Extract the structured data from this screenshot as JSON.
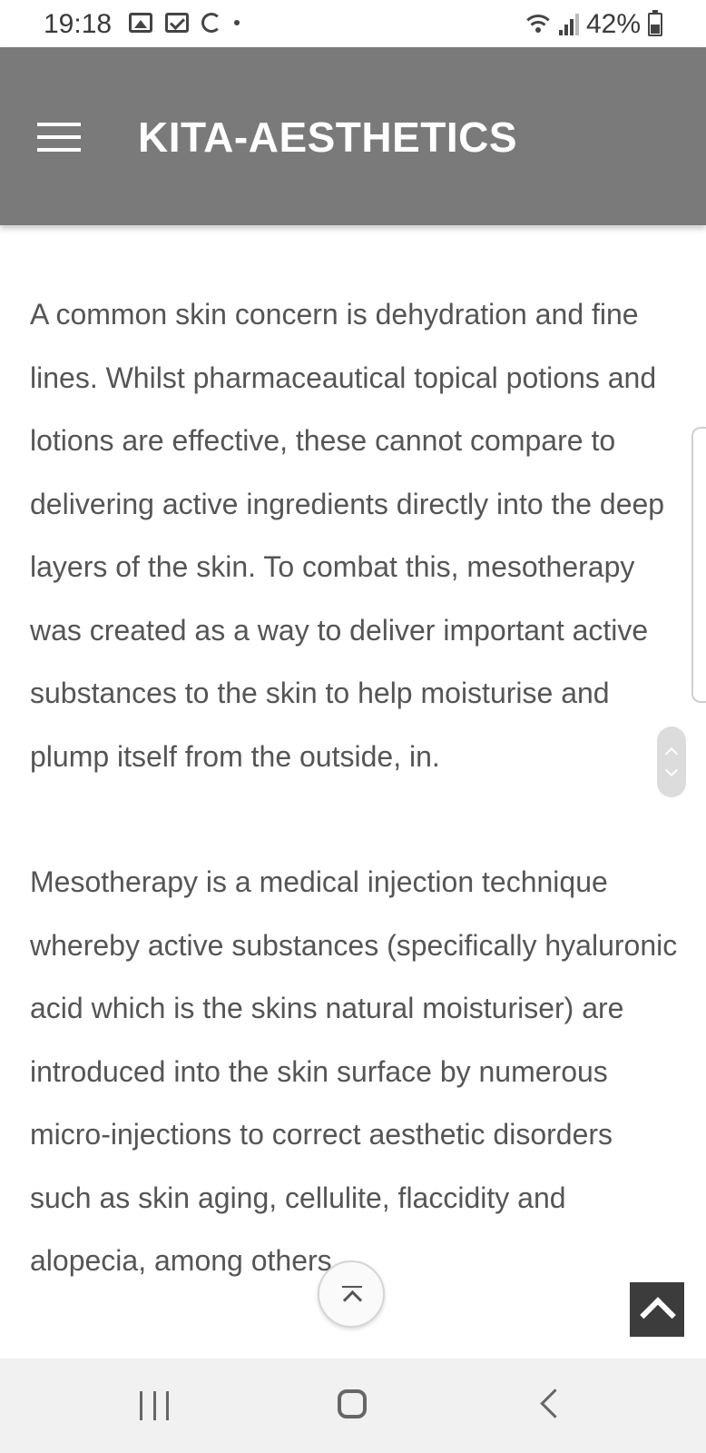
{
  "status_bar": {
    "time": "19:18",
    "battery": "42%",
    "left_icons": [
      "image-icon",
      "mail-icon",
      "sync-icon",
      "dot-icon"
    ],
    "right_icons": [
      "wifi-icon",
      "signal-icon",
      "battery-icon"
    ]
  },
  "header": {
    "title": "KITA-AESTHETICS",
    "background": "#7a7a7a",
    "menu_icon": "hamburger-menu-icon"
  },
  "article": {
    "paragraphs": [
      "A common skin concern is dehydration and fine lines. Whilst pharmaceautical topical potions and lotions are effective, these cannot compare to delivering active ingredients directly into the deep layers of the skin. To combat this, mesotherapy was created as a way to deliver important active substances to the skin to help moisturise and plump itself from the outside, in.",
      "Mesotherapy is a medical injection technique whereby active substances (specifically hyaluronic acid which is the skins natural moisturiser) are introduced into the skin surface by numerous micro-injections to correct aesthetic disorders such as skin aging, cellulite, flaccidity and alopecia, among others."
    ]
  },
  "controls": {
    "scroll_handle": "scroll-handle",
    "float_top_icon": "scroll-to-top-icon",
    "back_to_top_icon": "chevron-up-icon"
  },
  "nav_bar": {
    "recents_icon": "recents-icon",
    "home_icon": "home-icon",
    "back_icon": "back-icon"
  }
}
